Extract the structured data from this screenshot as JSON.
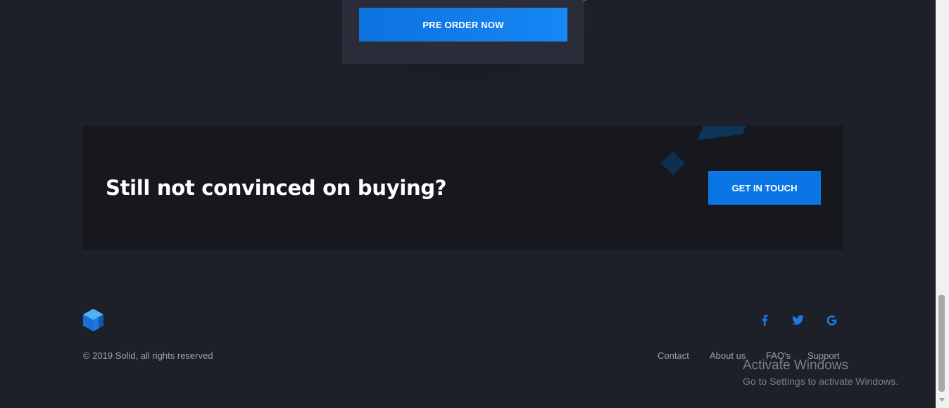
{
  "pricing_card": {
    "preorder_label": "PRE ORDER NOW"
  },
  "cta": {
    "title": "Still not convinced on buying?",
    "button_label": "GET IN TOUCH"
  },
  "footer": {
    "logo_icon": "hexagon-cube-logo-icon",
    "copyright": "© 2019 Solid, all rights reserved",
    "social": [
      {
        "icon": "facebook-icon",
        "color": "#1a7be6"
      },
      {
        "icon": "twitter-icon",
        "color": "#1a7be6"
      },
      {
        "icon": "google-icon",
        "color": "#1a7be6"
      }
    ],
    "links": [
      "Contact",
      "About us",
      "FAQ's",
      "Support"
    ]
  },
  "watermark": {
    "title": "Activate Windows",
    "subtitle": "Go to Settings to activate Windows."
  },
  "colors": {
    "background": "#1e2029",
    "cta_background": "#16181d",
    "accent": "#0c75e6",
    "muted_text": "#9ba0ad"
  }
}
